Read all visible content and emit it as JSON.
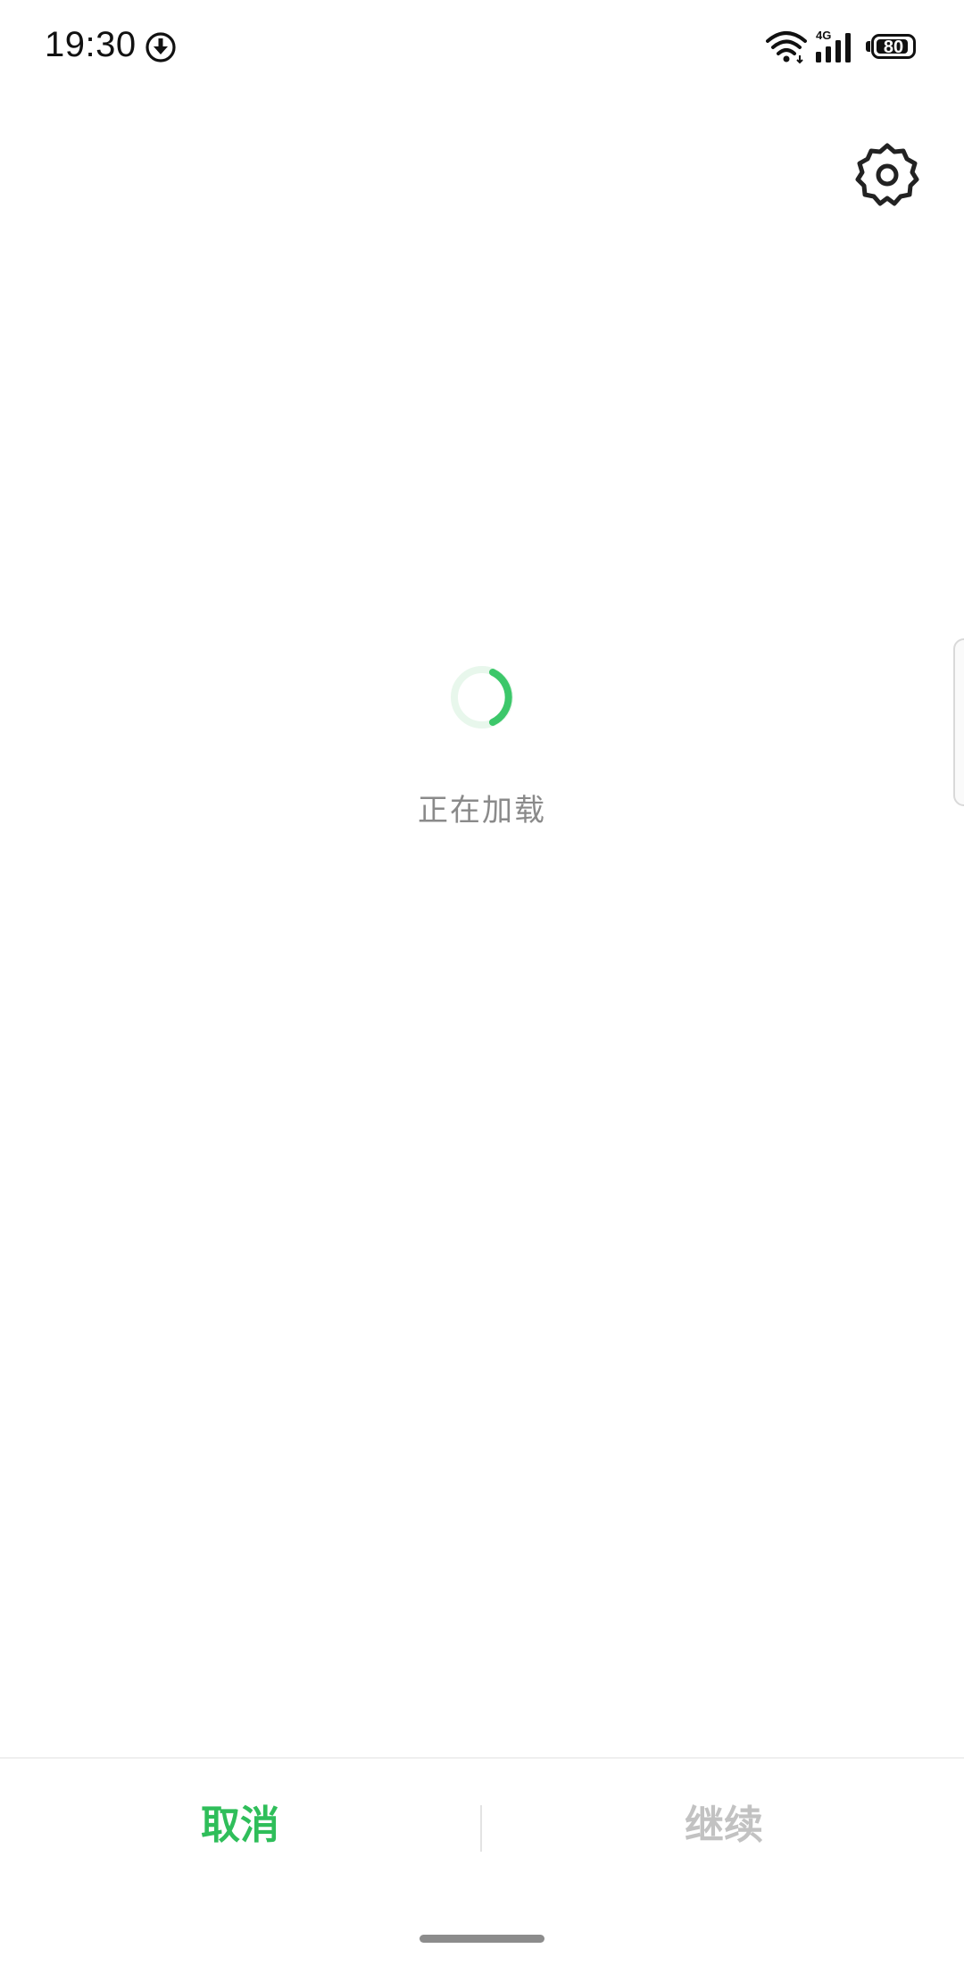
{
  "status_bar": {
    "time": "19:30",
    "download_icon": "download-circle-icon",
    "wifi_icon": "wifi-icon",
    "network_type": "4G",
    "signal_icon": "cellular-signal-icon",
    "battery_level": "80"
  },
  "header": {
    "settings_icon": "gear-icon"
  },
  "loading": {
    "text": "正在加载",
    "spinner_color": "#3cc76a",
    "spinner_track_color": "#e8f7ec"
  },
  "bottom_bar": {
    "cancel_label": "取消",
    "continue_label": "继续",
    "cancel_color": "#2fbe5a",
    "continue_color": "#c2c2c2"
  }
}
